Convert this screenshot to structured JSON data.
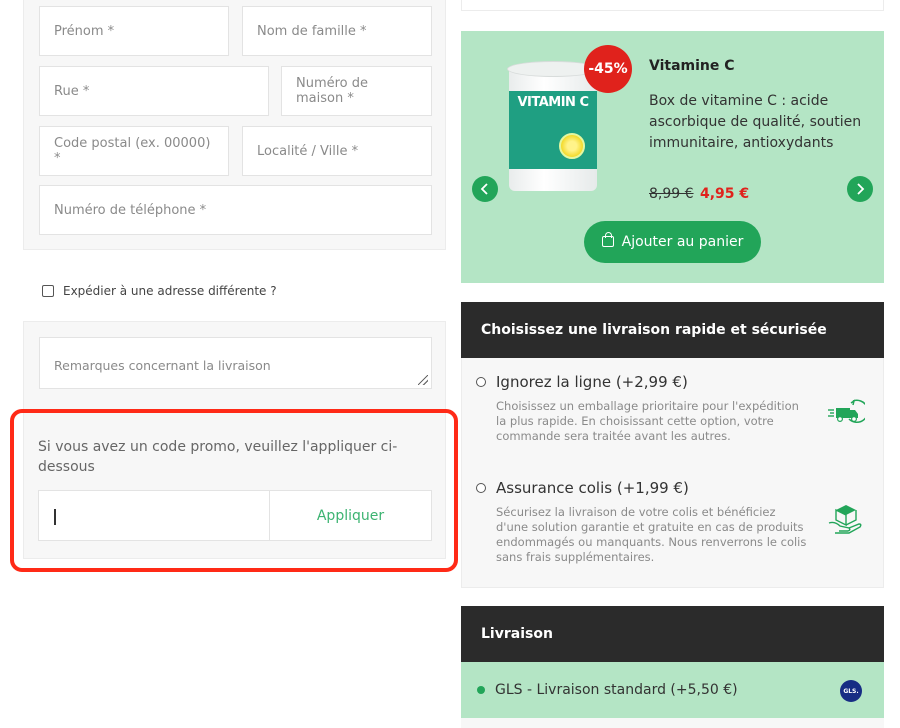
{
  "address_form": {
    "first_name_placeholder": "Prénom *",
    "last_name_placeholder": "Nom de famille *",
    "street_placeholder": "Rue *",
    "house_number_placeholder": "Numéro de maison *",
    "postal_code_placeholder": "Code postal (ex. 00000) *",
    "city_placeholder": "Localité / Ville *",
    "phone_placeholder": "Numéro de téléphone *"
  },
  "ship_different": {
    "label": "Expédier à une adresse différente ?",
    "checked": false
  },
  "remarks": {
    "placeholder": "Remarques concernant la livraison"
  },
  "promo": {
    "prompt": "Si vous avez un code promo, veuillez l'appliquer ci-dessous",
    "input_value": "",
    "apply_label": "Appliquer"
  },
  "product_offer": {
    "can_label": "VITAMIN C",
    "discount_badge": "-45%",
    "name": "Vitamine C",
    "description": "Box de vitamine C : acide ascorbique de qualité, soutien immunitaire, antioxydants",
    "old_price": "8,99 €",
    "new_price": "4,95 €",
    "add_to_cart_label": "Ajouter au panier"
  },
  "fast_shipping": {
    "header": "Choisissez une livraison rapide et sécurisée",
    "options": [
      {
        "title": "Ignorez la ligne (+2,99 €)",
        "description": "Choisissez un emballage prioritaire pour l'expédition la plus rapide. En choisissant cette option, votre commande sera traitée avant les autres.",
        "icon": "fast-truck-icon"
      },
      {
        "title": "Assurance colis (+1,99 €)",
        "description": "Sécurisez la livraison de votre colis et bénéficiez d'une solution garantie et gratuite en cas de produits endommagés ou manquants. Nous renverrons le colis sans frais supplémentaires.",
        "icon": "insured-package-icon"
      }
    ]
  },
  "delivery": {
    "header": "Livraison",
    "selected_option": "GLS - Livraison standard (+5,50 €)",
    "carrier_logo_text": "GLS."
  },
  "colors": {
    "accent_green": "#22a559",
    "light_green_bg": "#b4e5c5",
    "dark_header": "#2b2b2b",
    "sale_red": "#e0221c",
    "highlight_outline": "#ff2a17"
  }
}
